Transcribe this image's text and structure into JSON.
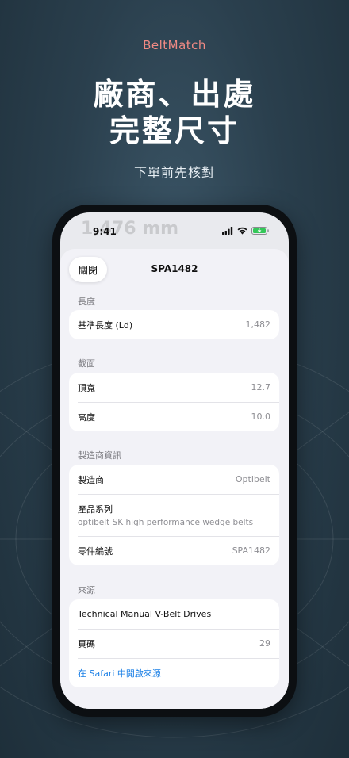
{
  "brand": "BeltMatch",
  "headline": {
    "line1": "廠商、出處",
    "line2": "完整尺寸"
  },
  "subline": "下單前先核對",
  "phone": {
    "background_text": "1,476 mm",
    "status": {
      "time": "9:41",
      "icons": [
        "signal-icon",
        "wifi-icon",
        "battery-charging-icon"
      ]
    },
    "sheet": {
      "close_label": "關閉",
      "title": "SPA1482",
      "sections": {
        "length": {
          "label": "長度",
          "rows": [
            {
              "label": "基準長度 (Ld)",
              "value": "1,482"
            }
          ]
        },
        "cross_section": {
          "label": "截面",
          "rows": [
            {
              "label": "頂寬",
              "value": "12.7"
            },
            {
              "label": "高度",
              "value": "10.0"
            }
          ]
        },
        "manufacturer": {
          "label": "製造商資訊",
          "rows": [
            {
              "label": "製造商",
              "value": "Optibelt"
            },
            {
              "label": "產品系列",
              "value": "optibelt SK high performance wedge belts"
            },
            {
              "label": "零件編號",
              "value": "SPA1482"
            }
          ]
        },
        "source": {
          "label": "來源",
          "rows": [
            {
              "label": "Technical Manual V-Belt Drives"
            },
            {
              "label": "頁碼",
              "value": "29"
            },
            {
              "label": "在 Safari 中開啟來源"
            }
          ]
        }
      }
    }
  },
  "colors": {
    "brand": "#f08a84",
    "link": "#1a7fe6",
    "background": "#2a3f4d"
  }
}
